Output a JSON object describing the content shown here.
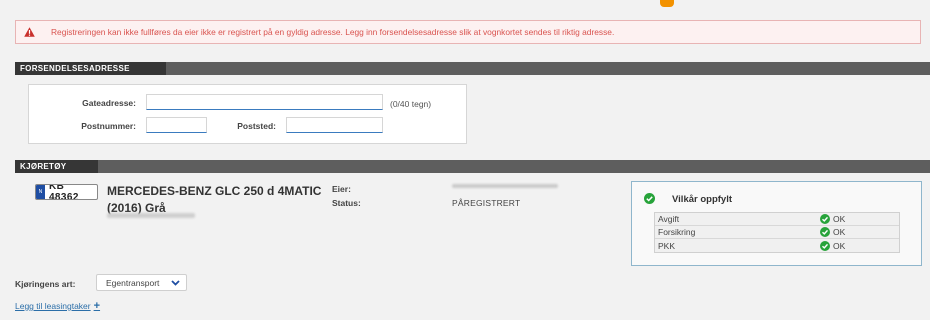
{
  "error": {
    "message": "Registreringen kan ikke fullføres da eier ikke er registrert på en gyldig adresse. Legg inn forsendelsesadresse slik at vognkortet sendes til riktig adresse.",
    "icon": "warning-triangle-icon",
    "color": "#d9534f"
  },
  "address_section": {
    "title": "FORSENDELSESADRESSE",
    "street_label": "Gateadresse:",
    "street_value": "",
    "street_counter": "(0/40 tegn)",
    "postal_code_label": "Postnummer:",
    "postal_code_value": "",
    "city_label": "Poststed:",
    "city_value": ""
  },
  "vehicle_section": {
    "title": "KJØRETØY",
    "plate": "KB 48362",
    "name": "MERCEDES-BENZ GLC 250 d 4MATIC (2016) Grå",
    "owner_label": "Eier:",
    "status_label": "Status:",
    "status_value": "PÅREGISTRERT"
  },
  "conditions": {
    "title": "Vilkår oppfylt",
    "color": "#27a33a",
    "rows": [
      {
        "name": "Avgift",
        "status": "OK"
      },
      {
        "name": "Forsikring",
        "status": "OK"
      },
      {
        "name": "PKK",
        "status": "OK"
      }
    ]
  },
  "driving": {
    "label": "Kjøringens art:",
    "selected": "Egentransport"
  },
  "lease_link": "Legg til leasingtaker"
}
